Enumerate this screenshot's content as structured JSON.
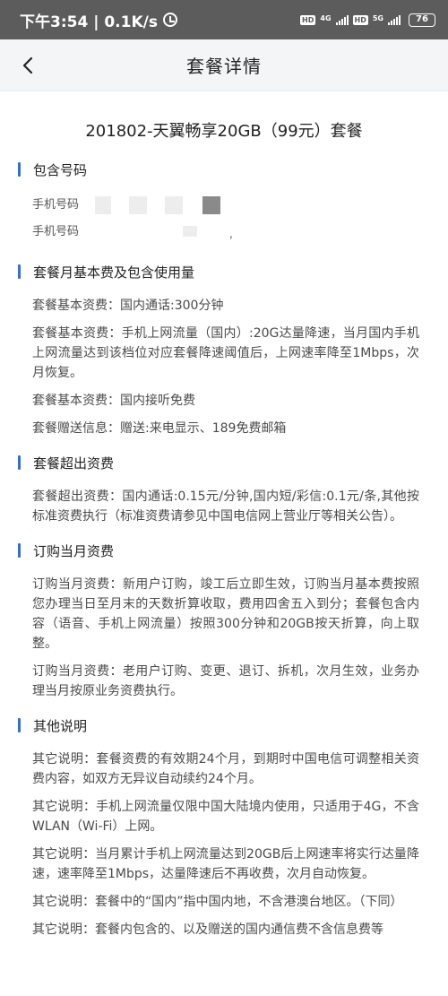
{
  "status_bar": {
    "time_speed": "下午3:54 | 0.1K/s",
    "hd1": "HD",
    "net1": "4G",
    "hd2": "HD",
    "net2": "5G",
    "battery": "76"
  },
  "nav": {
    "title": "套餐详情"
  },
  "plan_title": "201802-天翼畅享20GB（99元）套餐",
  "sections": [
    {
      "title": "包含号码",
      "phones": [
        "手机号码",
        "手机号码"
      ]
    },
    {
      "title": "套餐月基本费及包含使用量",
      "paragraphs": [
        "套餐基本资费：国内通话:300分钟",
        "套餐基本资费：手机上网流量（国内）:20G达量降速，当月国内手机上网流量达到该档位对应套餐降速阈值后，上网速率降至1Mbps，次月恢复。",
        "套餐基本资费：国内接听免费",
        "套餐赠送信息：赠送:来电显示、189免费邮箱"
      ]
    },
    {
      "title": "套餐超出资费",
      "paragraphs": [
        "套餐超出资费：国内通话:0.15元/分钟,国内短/彩信:0.1元/条,其他按标准资费执行（标准资费请参见中国电信网上营业厅等相关公告）。"
      ]
    },
    {
      "title": "订购当月资费",
      "paragraphs": [
        "订购当月资费：新用户订购，竣工后立即生效，订购当月基本费按照您办理当日至月末的天数折算收取，费用四舍五入到分；套餐包含内容（语音、手机上网流量）按照300分钟和20GB按天折算，向上取整。",
        "订购当月资费：老用户订购、变更、退订、拆机，次月生效，业务办理当月按原业务资费执行。"
      ]
    },
    {
      "title": "其他说明",
      "paragraphs": [
        "其它说明：套餐资费的有效期24个月，到期时中国电信可调整相关资费内容，如双方无异议自动续约24个月。",
        "其它说明：手机上网流量仅限中国大陆境内使用，只适用于4G，不含WLAN（Wi-Fi）上网。",
        "其它说明：当月累计手机上网流量达到20GB后上网速率将实行达量降速，速率降至1Mbps，达量降速后不再收费，次月自动恢复。",
        "其它说明：套餐中的“国内”指中国内地，不含港澳台地区。（下同）",
        "其它说明：套餐内包含的、以及赠送的国内通信费不含信息费等"
      ]
    }
  ],
  "colors": {
    "accent": "#2d6fdc",
    "status_bar_bg": "#5c5c5c"
  },
  "icons": {
    "back": "chevron-left-icon",
    "alarm": "alarm-icon"
  }
}
